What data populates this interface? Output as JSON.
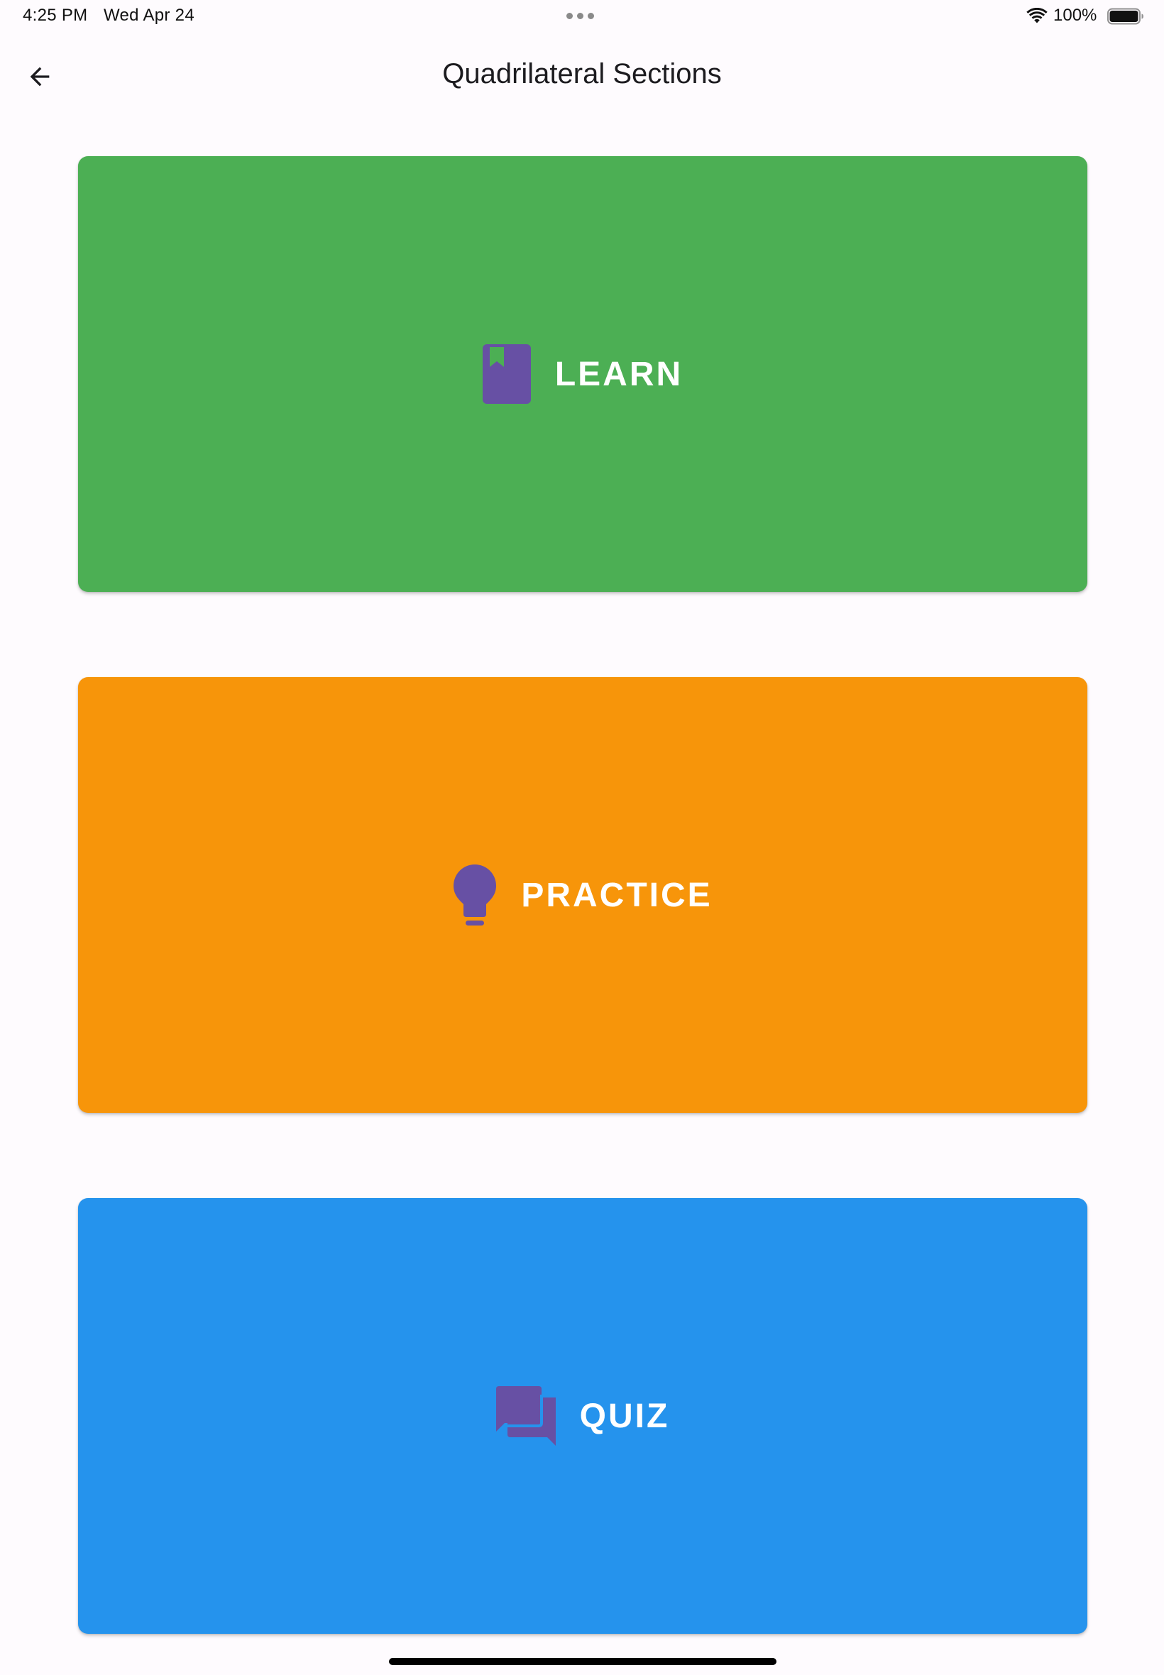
{
  "status_bar": {
    "time": "4:25 PM",
    "date": "Wed Apr 24",
    "battery": "100%"
  },
  "app_bar": {
    "title": "Quadrilateral Sections",
    "back_icon": "arrow-back-icon"
  },
  "sections": [
    {
      "label": "LEARN",
      "icon": "book-icon",
      "color": "#4caf54"
    },
    {
      "label": "PRACTICE",
      "icon": "lightbulb-icon",
      "color": "#f7950a"
    },
    {
      "label": "QUIZ",
      "icon": "forum-icon",
      "color": "#2593ed"
    }
  ],
  "colors": {
    "icon_purple": "#6750a4",
    "text_on_card": "#ffffff",
    "background": "#fefbfe"
  }
}
